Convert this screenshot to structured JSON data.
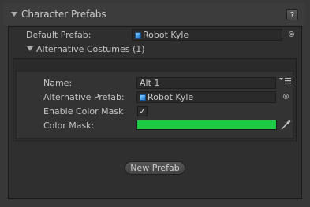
{
  "header": {
    "title": "Character Prefabs",
    "help_label": "?"
  },
  "default_prefab": {
    "label": "Default Prefab:",
    "value": "Robot Kyle",
    "icon": "prefab-cube-icon"
  },
  "alternatives": {
    "title": "Alternative Costumes (1)",
    "items": [
      {
        "name_label": "Name:",
        "name_value": "Alt 1",
        "menu_icon": "list-menu-icon",
        "prefab_label": "Alternative Prefab:",
        "prefab_value": "Robot Kyle",
        "mask_toggle_label": "Enable Color Mask",
        "mask_toggle_checked": true,
        "check_glyph": "✓",
        "color_label": "Color Mask:",
        "color_value": "#1fc944",
        "eyedropper_icon": "eyedropper-icon"
      }
    ]
  },
  "new_prefab_label": "New Prefab"
}
